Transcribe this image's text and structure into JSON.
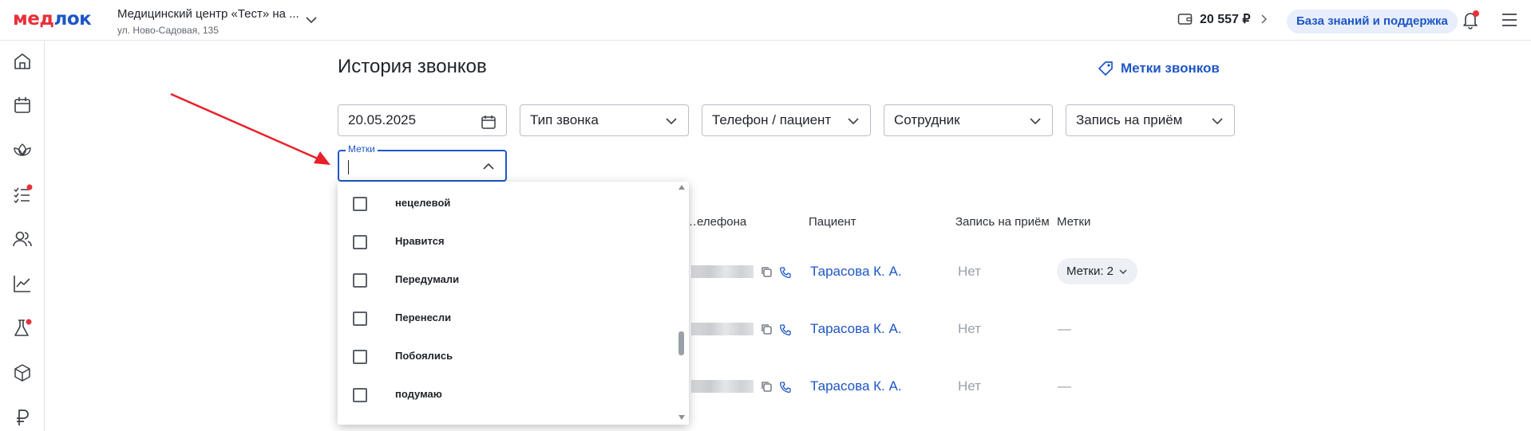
{
  "header": {
    "logo_part1": "мед",
    "logo_part2": "лок",
    "clinic_name": "Медицинский центр «Тест» на ...",
    "clinic_address": "ул. Ново-Садовая, 135",
    "balance": "20 557 ₽",
    "knowledge_button": "База знаний и поддержка"
  },
  "page": {
    "title": "История звонков",
    "tags_link": "Метки звонков"
  },
  "filters": {
    "date": "20.05.2025",
    "call_type": "Тип звонка",
    "phone_patient": "Телефон / пациент",
    "employee": "Сотрудник",
    "appointment": "Запись на приём",
    "tags_label": "Метки"
  },
  "table": {
    "headers": [
      "…елефона",
      "Пациент",
      "Запись на приём",
      "Метки"
    ],
    "rows": [
      {
        "patient": "Тарасова К. А.",
        "appointment": "Нет",
        "tags": "Метки: 2"
      },
      {
        "patient": "Тарасова К. А.",
        "appointment": "Нет",
        "tags": "—"
      },
      {
        "patient": "Тарасова К. А.",
        "appointment": "Нет",
        "tags": "—"
      }
    ]
  },
  "dropdown": {
    "options": [
      "нецелевой",
      "Нравится",
      "Передумали",
      "Перенесли",
      "Побоялись",
      "подумаю"
    ]
  },
  "colors": {
    "brand_blue": "#1d56c6",
    "brand_red": "#e8303a",
    "annotation_arrow": "#e8202a"
  },
  "sidebar_icons": [
    "home-icon",
    "calendar-icon",
    "lotus-icon",
    "checklist-icon",
    "users-icon",
    "chart-icon",
    "flask-icon",
    "box-icon",
    "ruble-icon"
  ]
}
